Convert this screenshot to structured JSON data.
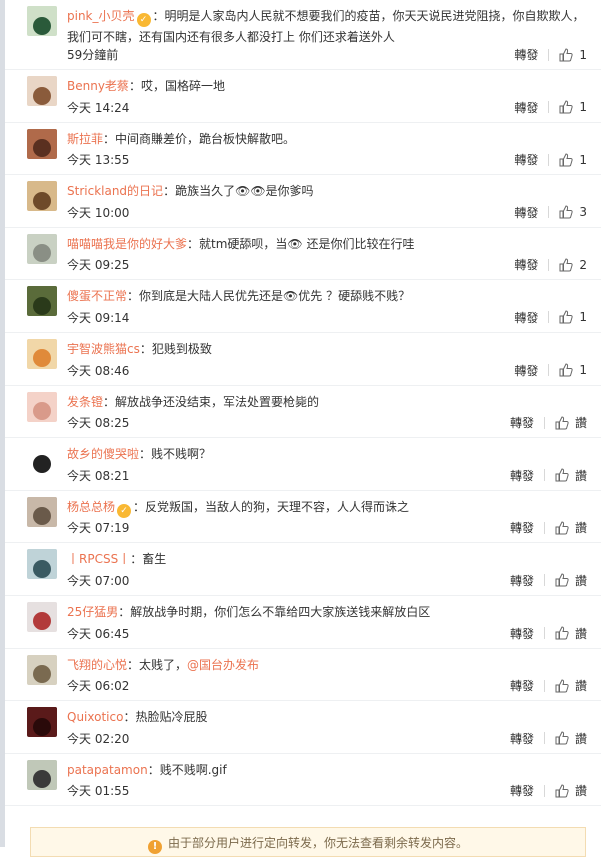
{
  "comments": [
    {
      "user": "pink_小贝壳",
      "verified": true,
      "sep": "：",
      "text": "明明是人家岛内人民就不想要我们的疫苗，你天天说民进党阻挠，你自欺欺人，我们可不瞎，还有国内还有很多人都没打上 你们还求着送外人",
      "time": "59分鐘前",
      "repost": "轉發",
      "likes": "1",
      "mention": "",
      "avatar": [
        "#cfe0c8",
        "#2a5a3a"
      ]
    },
    {
      "user": "Benny老蔡",
      "verified": false,
      "sep": "：",
      "text": "哎，国格碎一地",
      "time": "今天 14:24",
      "repost": "轉發",
      "likes": "1",
      "mention": "",
      "avatar": [
        "#e9d6c6",
        "#8a5b3b"
      ]
    },
    {
      "user": "斯拉菲",
      "verified": false,
      "sep": "：",
      "text": "中间商賺差价，跪台板快解散吧。",
      "time": "今天 13:55",
      "repost": "轉發",
      "likes": "1",
      "mention": "",
      "avatar": [
        "#b06a4a",
        "#5a3020"
      ]
    },
    {
      "user": "Strickland的日记",
      "verified": false,
      "sep": "：",
      "text": "跪族当久了👁👁是你爹吗",
      "time": "今天 10:00",
      "repost": "轉發",
      "likes": "3",
      "mention": "",
      "avatar": [
        "#d8b98a",
        "#6e4a2a"
      ]
    },
    {
      "user": "喵喵喵我是你的好大爹",
      "verified": false,
      "sep": "：",
      "text": "就tm硬舔呗，当👁 还是你们比较在行哇",
      "time": "今天 09:25",
      "repost": "轉發",
      "likes": "2",
      "mention": "",
      "avatar": [
        "#c9d1c3",
        "#8a8f85"
      ]
    },
    {
      "user": "傻蛋不正常",
      "verified": false,
      "sep": "：",
      "text": "你到底是大陆人民优先还是👁优先 ？硬舔贱不贱？",
      "time": "今天 09:14",
      "repost": "轉發",
      "likes": "1",
      "mention": "",
      "avatar": [
        "#5a6b3a",
        "#2a3a1a"
      ]
    },
    {
      "user": "宇智波熊猫cs",
      "verified": false,
      "sep": "：",
      "text": "犯贱到极致",
      "time": "今天 08:46",
      "repost": "轉發",
      "likes": "1",
      "mention": "",
      "avatar": [
        "#f1d7a8",
        "#e08a3a"
      ]
    },
    {
      "user": "发条镫",
      "verified": false,
      "sep": "：",
      "text": "解放战争还没结束，军法处置要枪毙的",
      "time": "今天 08:25",
      "repost": "轉發",
      "likes": "讚",
      "mention": "",
      "avatar": [
        "#f4d2c8",
        "#d99a8a"
      ]
    },
    {
      "user": "故乡的傻哭啦",
      "verified": false,
      "sep": "：",
      "text": "贱不贱啊？",
      "time": "今天 08:21",
      "repost": "轉發",
      "likes": "讚",
      "mention": "",
      "avatar": [
        "#ffffff",
        "#222222"
      ]
    },
    {
      "user": "杨总总杨",
      "verified": true,
      "sep": "：",
      "text": "反党叛国，当敌人的狗，天理不容，人人得而诛之",
      "time": "今天 07:19",
      "repost": "轉發",
      "likes": "讚",
      "mention": "",
      "avatar": [
        "#c8b8a8",
        "#6a5a4a"
      ]
    },
    {
      "user": "丨RPCSS丨",
      "verified": false,
      "sep": "：",
      "text": "畜生",
      "time": "今天 07:00",
      "repost": "轉發",
      "likes": "讚",
      "mention": "",
      "avatar": [
        "#bfd3d8",
        "#3a5a62"
      ]
    },
    {
      "user": "25仔猛男",
      "verified": false,
      "sep": "：",
      "text": "解放战争时期，你们怎么不靠给四大家族送钱来解放白区",
      "time": "今天 06:45",
      "repost": "轉發",
      "likes": "讚",
      "mention": "",
      "avatar": [
        "#e6e0e0",
        "#b23a3a"
      ]
    },
    {
      "user": "飞翔的心悦",
      "verified": false,
      "sep": "：",
      "text": "太贱了，",
      "time": "今天 06:02",
      "repost": "轉發",
      "likes": "讚",
      "mention": "@国台办发布",
      "avatar": [
        "#d7d1c0",
        "#7a6a50"
      ]
    },
    {
      "user": "Quixotico",
      "verified": false,
      "sep": "：",
      "text": "热脸贴冷屁股",
      "time": "今天 02:20",
      "repost": "轉發",
      "likes": "讚",
      "mention": "",
      "avatar": [
        "#5a1a1a",
        "#2a0a0a"
      ]
    },
    {
      "user": "patapatamon",
      "verified": false,
      "sep": "：",
      "text": "贱不贱啊.gif",
      "time": "今天 01:55",
      "repost": "轉發",
      "likes": "讚",
      "mention": "",
      "avatar": [
        "#c0c8b8",
        "#3a3a3a"
      ]
    }
  ],
  "notice": {
    "icon": "!",
    "text": "由于部分用户进行定向转发，你无法查看剩余转发内容。"
  },
  "colors": {
    "username": "#eb7350",
    "text": "#333333",
    "notice_bg": "#fff8e8"
  }
}
